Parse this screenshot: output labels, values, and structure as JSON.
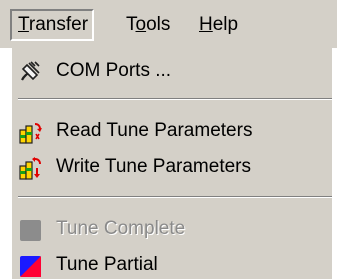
{
  "menubar": {
    "transfer_label": "Transfer",
    "tools_label": "Tools",
    "help_label": "Help"
  },
  "dropdown": {
    "com_ports_label": "COM Ports ...",
    "read_tune_label": "Read Tune Parameters",
    "write_tune_label": "Write Tune Parameters",
    "tune_complete_label": "Tune Complete",
    "tune_partial_label": "Tune Partial"
  },
  "icons": {
    "com_ports": "plug-icon",
    "read_tune": "read-tune-icon",
    "write_tune": "write-tune-icon",
    "tune_complete": "gray-square-icon",
    "tune_partial": "blue-red-square-icon"
  },
  "colors": {
    "menu_background": "#d4d0c8",
    "disabled_text": "#8a8a8a",
    "partial_blue": "#1a1aff",
    "partial_red": "#ff0033"
  }
}
